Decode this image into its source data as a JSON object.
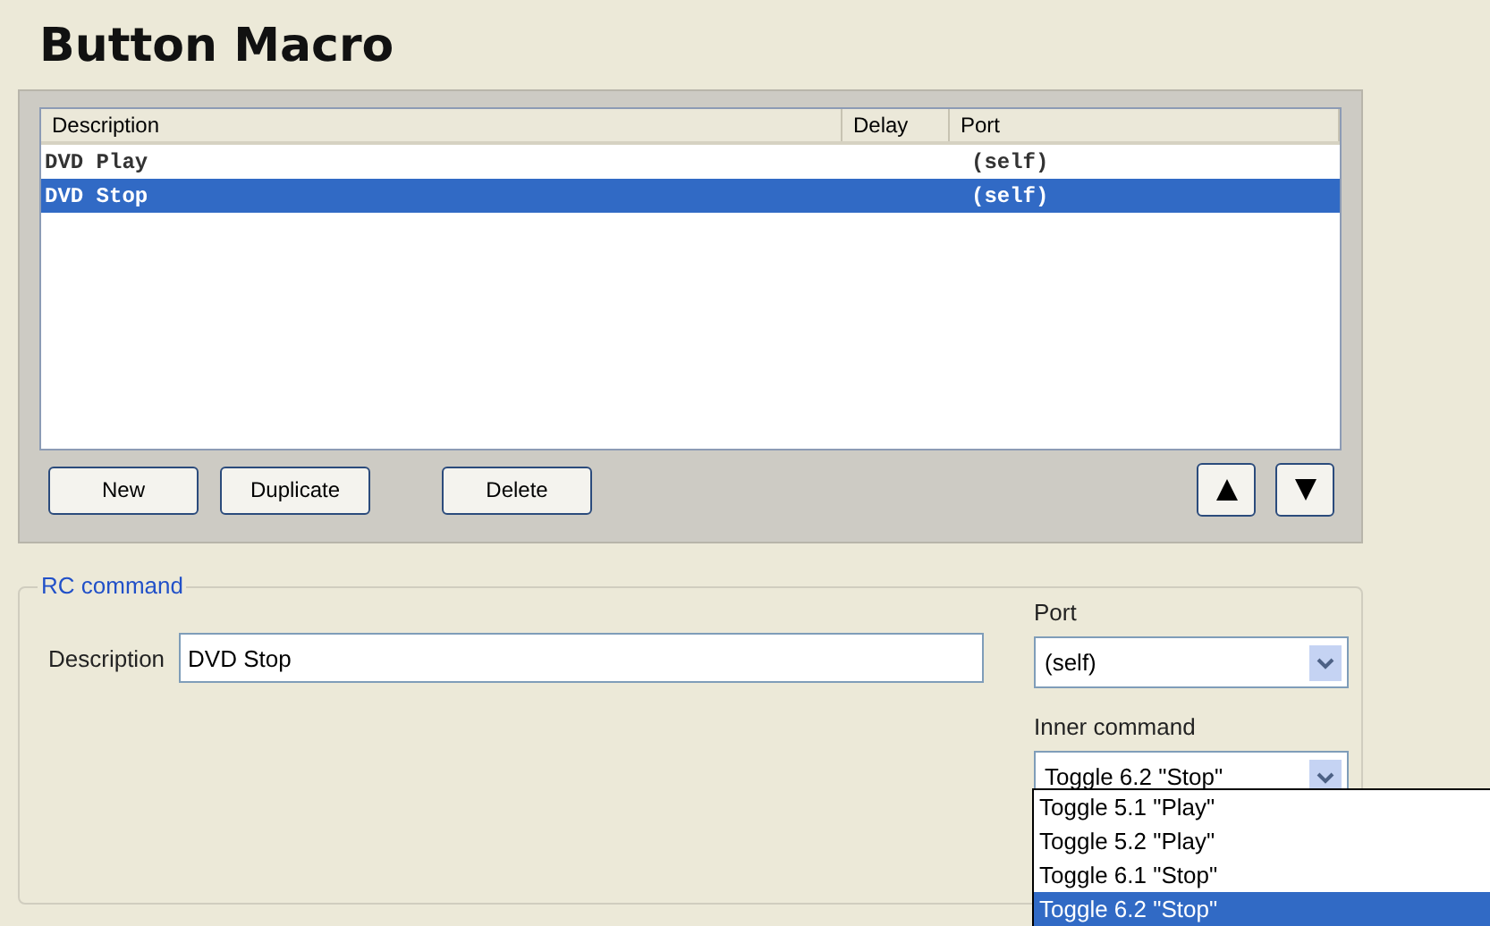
{
  "title": "Button Macro",
  "macro_list": {
    "columns": [
      "Description",
      "Delay",
      "Port"
    ],
    "rows": [
      {
        "description": "DVD Play",
        "port": "(self)",
        "selected": false
      },
      {
        "description": "DVD Stop",
        "port": "(self)",
        "selected": true
      }
    ]
  },
  "list_buttons": [
    "New",
    "Duplicate",
    "Delete"
  ],
  "rc_command": {
    "legend": "RC command",
    "description_label": "Description",
    "description_value": "DVD Stop",
    "port_label": "Port",
    "port_value": "(self)",
    "inner_command_label": "Inner command",
    "inner_command_value": "Toggle 6.2 \"Stop\"",
    "inner_command_options": [
      {
        "label": "Toggle 5.1 \"Play\"",
        "selected": false
      },
      {
        "label": "Toggle 5.2 \"Play\"",
        "selected": false
      },
      {
        "label": "Toggle 6.1 \"Stop\"",
        "selected": false
      },
      {
        "label": "Toggle 6.2 \"Stop\"",
        "selected": true
      }
    ]
  }
}
